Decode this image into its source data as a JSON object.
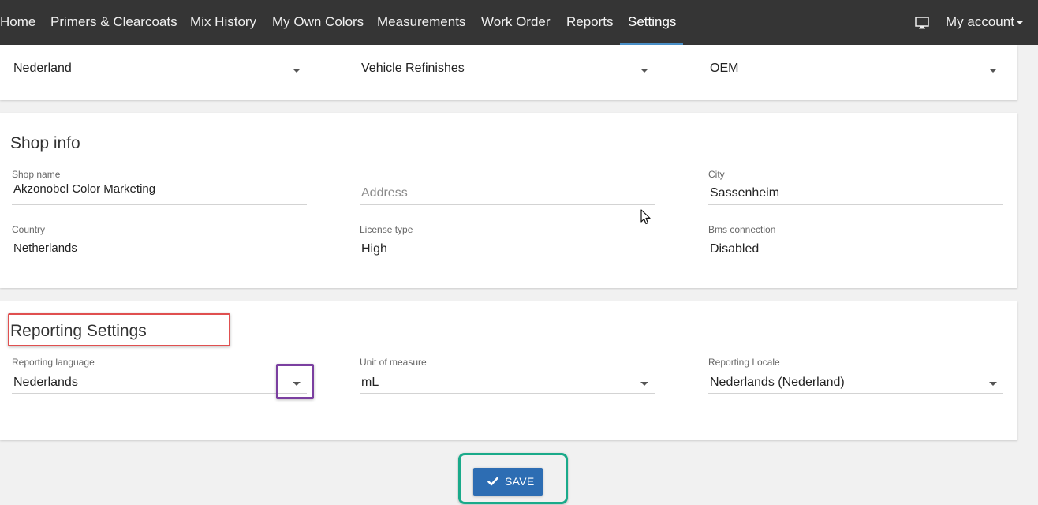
{
  "nav": {
    "items": [
      {
        "label": "Home"
      },
      {
        "label": "Primers & Clearcoats"
      },
      {
        "label": "Mix History"
      },
      {
        "label": "My Own Colors"
      },
      {
        "label": "Measurements"
      },
      {
        "label": "Work Order"
      },
      {
        "label": "Reports"
      },
      {
        "label": "Settings",
        "active": true
      }
    ],
    "account_label": "My account",
    "monitor_icon": "monitor-icon",
    "accent_color": "#4a90c8"
  },
  "top_section": {
    "fields": [
      {
        "value": "Nederland"
      },
      {
        "value": "Vehicle Refinishes"
      },
      {
        "value": "OEM"
      }
    ]
  },
  "shop_info": {
    "title": "Shop info",
    "shop_name": {
      "label": "Shop name",
      "value": "Akzonobel Color Marketing"
    },
    "address": {
      "placeholder": "Address"
    },
    "city": {
      "label": "City",
      "value": "Sassenheim"
    },
    "country": {
      "label": "Country",
      "value": "Netherlands"
    },
    "license_type": {
      "label": "License type",
      "value": "High"
    },
    "bms_connection": {
      "label": "Bms connection",
      "value": "Disabled"
    }
  },
  "reporting_settings": {
    "title": "Reporting Settings",
    "language": {
      "label": "Reporting language",
      "value": "Nederlands"
    },
    "unit": {
      "label": "Unit of measure",
      "value": "mL"
    },
    "locale": {
      "label": "Reporting Locale",
      "value": "Nederlands (Nederland)"
    }
  },
  "save_button": {
    "label": "SAVE",
    "icon": "check-icon",
    "color": "#2d6db3"
  },
  "annotations": {
    "title_box_color": "#e05050",
    "dropdown_box_color": "#7b3fa0",
    "save_box_color": "#1aaa8a"
  }
}
